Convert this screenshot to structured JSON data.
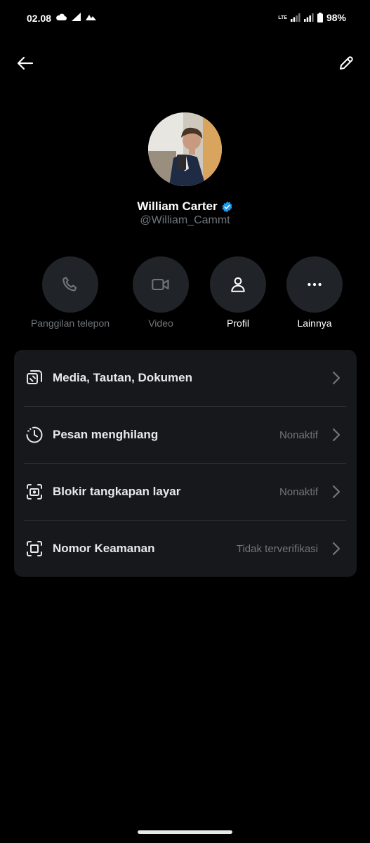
{
  "status_bar": {
    "time": "02.08",
    "network": "LTE",
    "battery": "98%"
  },
  "profile": {
    "name": "William Carter",
    "handle": "@William_Cammt",
    "verified": true,
    "verified_color": "#1d9bf0"
  },
  "actions": [
    {
      "label": "Panggilan telepon",
      "icon": "phone-icon",
      "enabled": false
    },
    {
      "label": "Video",
      "icon": "video-icon",
      "enabled": false
    },
    {
      "label": "Profil",
      "icon": "person-icon",
      "enabled": true
    },
    {
      "label": "Lainnya",
      "icon": "more-icon",
      "enabled": true
    }
  ],
  "settings": [
    {
      "label": "Media, Tautan, Dokumen",
      "value": "",
      "icon": "media-icon"
    },
    {
      "label": "Pesan menghilang",
      "value": "Nonaktif",
      "icon": "timer-icon"
    },
    {
      "label": "Blokir tangkapan layar",
      "value": "Nonaktif",
      "icon": "screenshot-icon"
    },
    {
      "label": "Nomor Keamanan",
      "value": "Tidak terverifikasi",
      "icon": "security-number-icon"
    }
  ],
  "colors": {
    "background": "#000000",
    "card": "#16181c",
    "button": "#202327",
    "muted_text": "#71767b"
  }
}
